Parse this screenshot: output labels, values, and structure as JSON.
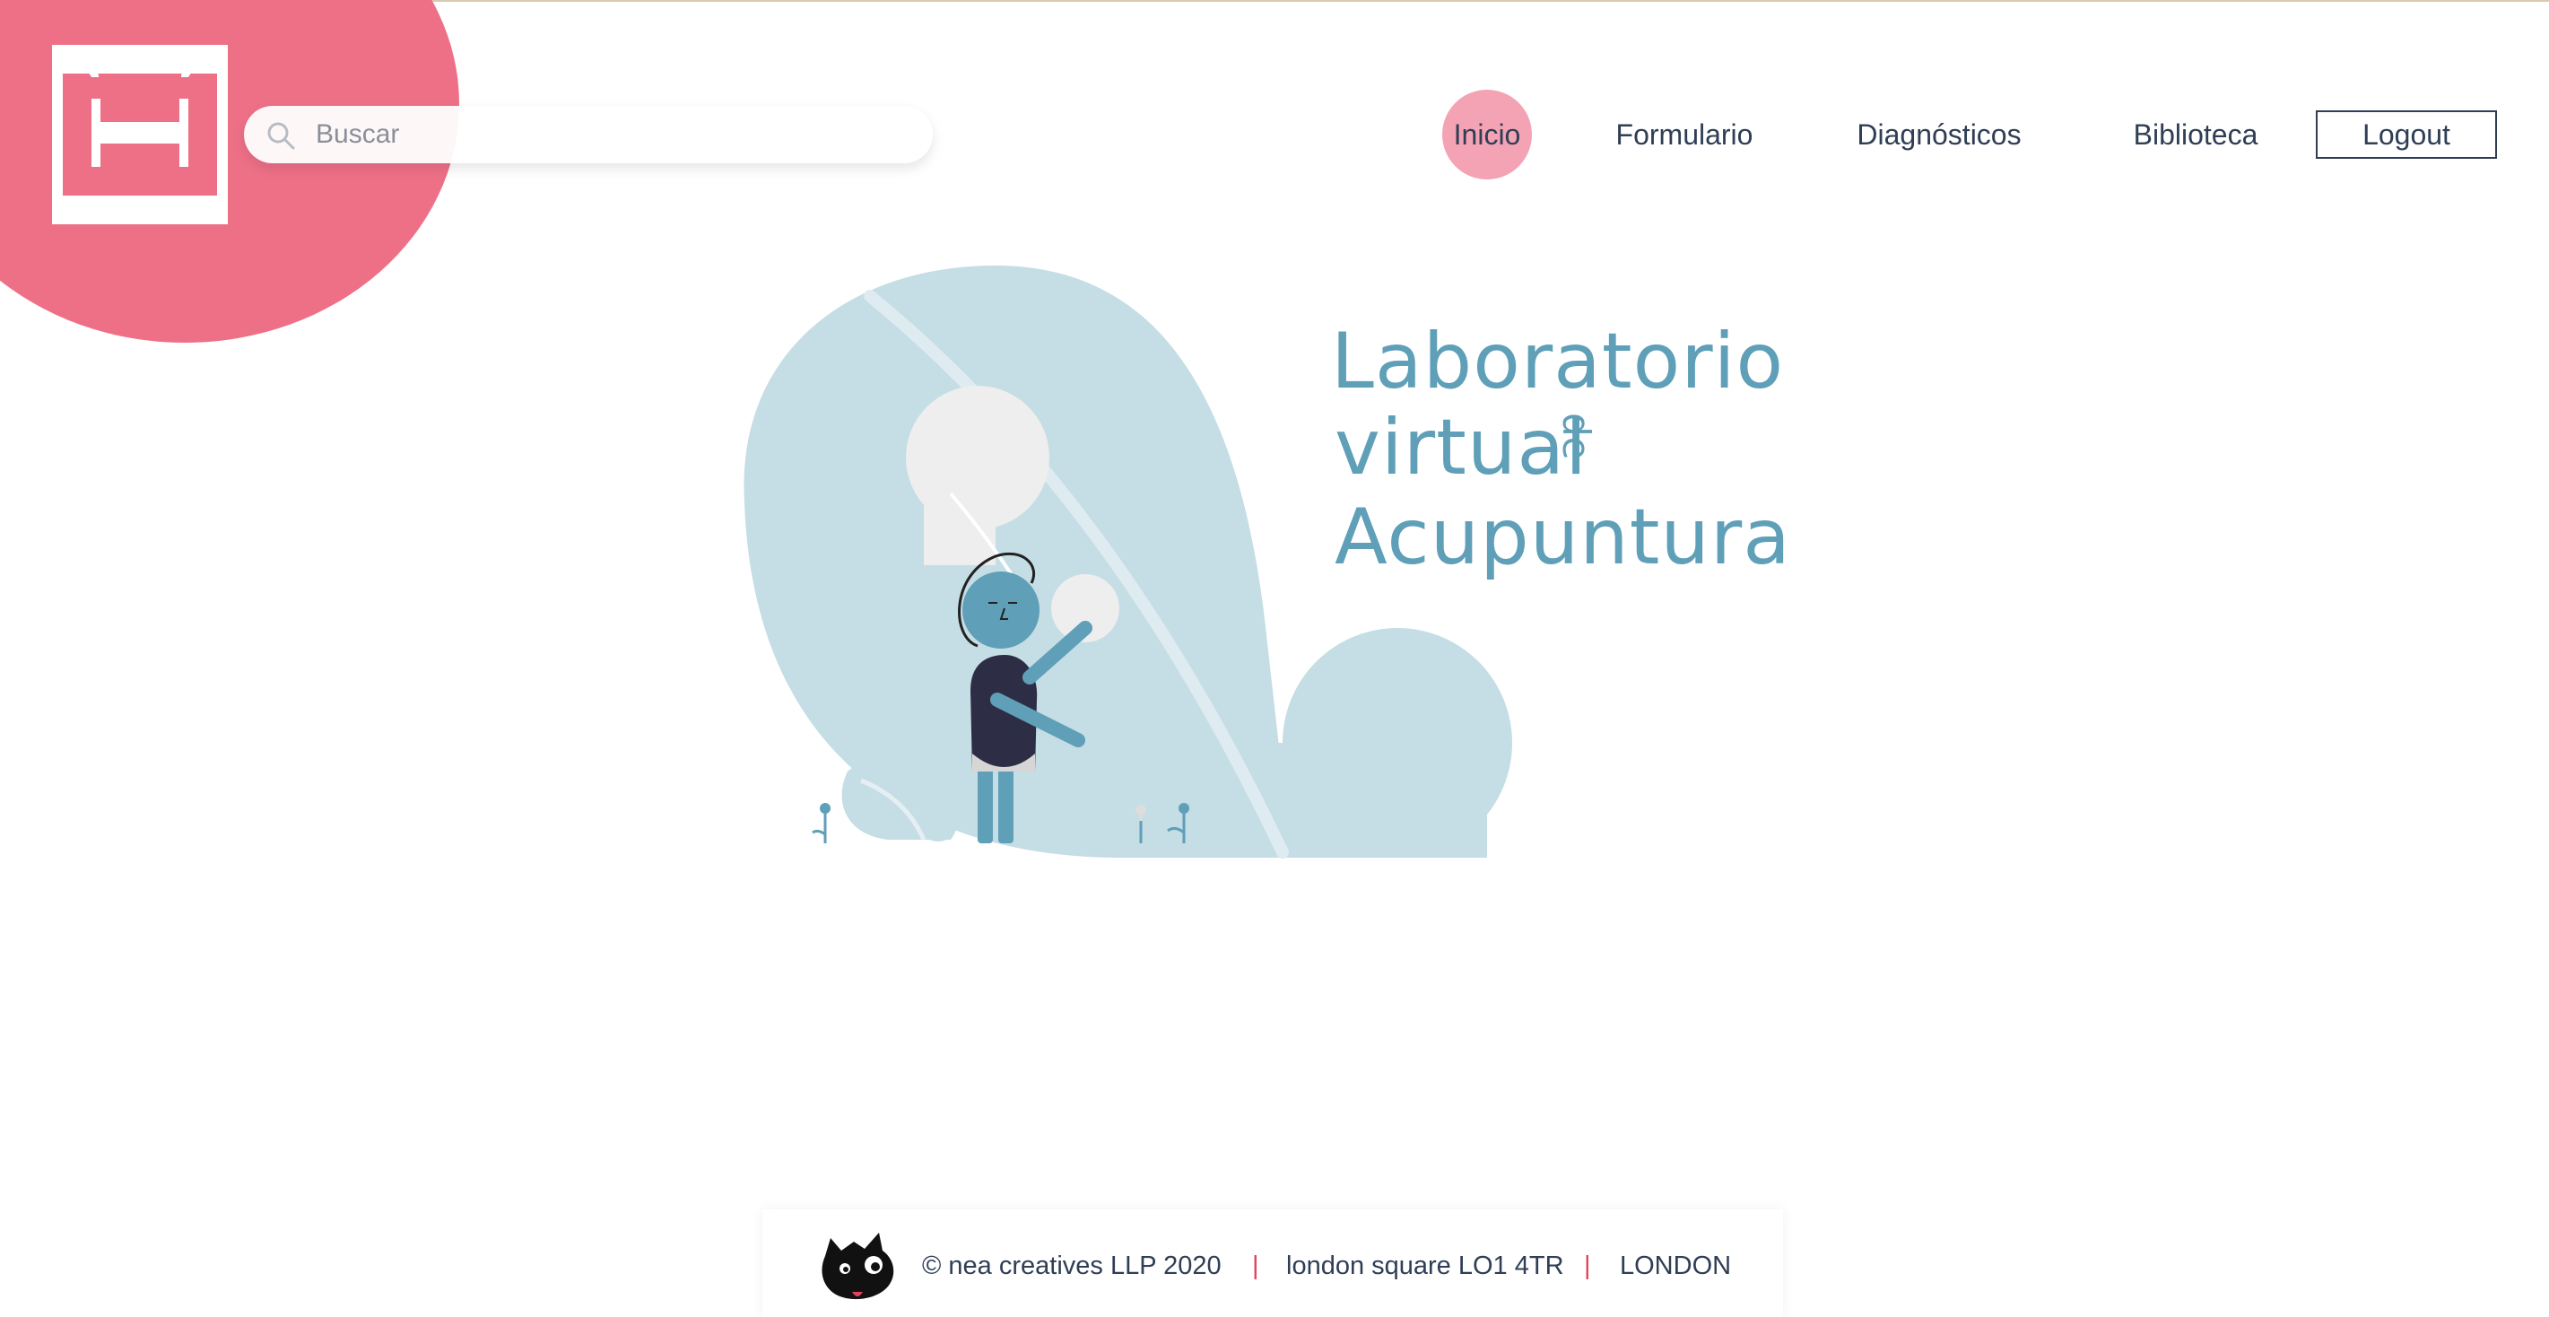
{
  "search": {
    "placeholder": "Buscar",
    "value": ""
  },
  "nav": {
    "items": [
      {
        "label": "Inicio",
        "active": true
      },
      {
        "label": "Formulario"
      },
      {
        "label": "Diagnósticos"
      },
      {
        "label": "Biblioteca"
      }
    ],
    "logout_label": "Logout"
  },
  "hero": {
    "title_line1": "Laboratorio",
    "title_line2": "virtual",
    "title_de": "de",
    "title_line3": "Acupuntura"
  },
  "footer": {
    "copyright": "© nea creatives LLP 2020",
    "separator": "|",
    "address": "london square LO1 4TR",
    "city": "LONDON"
  },
  "colors": {
    "brand_pink": "#ee7087",
    "active_pink": "#f3a3b3",
    "title_blue": "#5f9fb8",
    "leaf_blue": "#c5dde4",
    "nav_text": "#2f3e55",
    "separator_red": "#e0425a"
  },
  "icons": {
    "logo": "xi-logo-icon",
    "search": "search-icon",
    "footer_mascot": "cat-mascot-icon"
  }
}
